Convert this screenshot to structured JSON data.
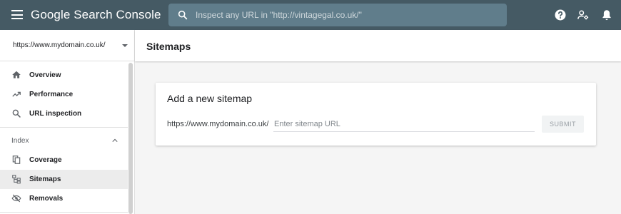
{
  "header": {
    "brand": "Google Search Console",
    "search_placeholder": "Inspect any URL in \"http://vintagegal.co.uk/\"",
    "icons": [
      "menu-icon",
      "search-icon",
      "help-icon",
      "manage-users-icon",
      "notifications-icon"
    ],
    "bar_color": "#455a64"
  },
  "sidebar": {
    "property": "https://www.mydomain.co.uk/",
    "nav": [
      {
        "label": "Overview",
        "icon": "home-icon"
      },
      {
        "label": "Performance",
        "icon": "trending-up-icon"
      },
      {
        "label": "URL inspection",
        "icon": "search-icon"
      }
    ],
    "index_section": {
      "label": "Index",
      "items": [
        {
          "label": "Coverage",
          "icon": "copy-icon"
        },
        {
          "label": "Sitemaps",
          "icon": "sitemap-icon",
          "active": true
        },
        {
          "label": "Removals",
          "icon": "visibility-off-icon"
        }
      ]
    }
  },
  "main": {
    "page_title": "Sitemaps",
    "card": {
      "title": "Add a new sitemap",
      "prefix": "https://www.mydomain.co.uk/",
      "input_placeholder": "Enter sitemap URL",
      "submit_label": "SUBMIT"
    }
  }
}
